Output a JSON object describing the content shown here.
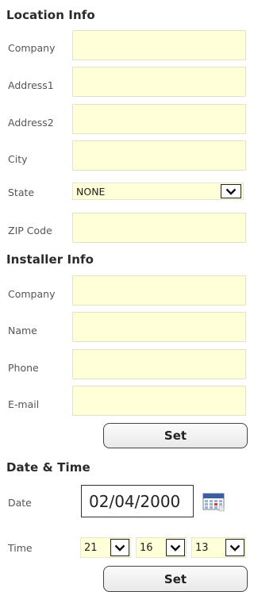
{
  "location": {
    "title": "Location Info",
    "fields": [
      {
        "label": "Company",
        "value": ""
      },
      {
        "label": "Address1",
        "value": ""
      },
      {
        "label": "Address2",
        "value": ""
      },
      {
        "label": "City",
        "value": ""
      }
    ],
    "state": {
      "label": "State",
      "value": "NONE"
    },
    "zip": {
      "label": "ZIP Code",
      "value": ""
    }
  },
  "installer": {
    "title": "Installer Info",
    "fields": [
      {
        "label": "Company",
        "value": ""
      },
      {
        "label": "Name",
        "value": ""
      },
      {
        "label": "Phone",
        "value": ""
      },
      {
        "label": "E-mail",
        "value": ""
      }
    ],
    "set_label": "Set"
  },
  "datetime": {
    "title": "Date & Time",
    "date_label": "Date",
    "date_value": "02/04/2000",
    "time_label": "Time",
    "hour": "21",
    "minute": "16",
    "second": "13",
    "set_label": "Set"
  },
  "colors": {
    "field_bg": "#ffffd8",
    "button_bg": "#efefef"
  },
  "icons": {
    "dropdown": "chevron-down-icon",
    "calendar": "calendar-icon"
  }
}
